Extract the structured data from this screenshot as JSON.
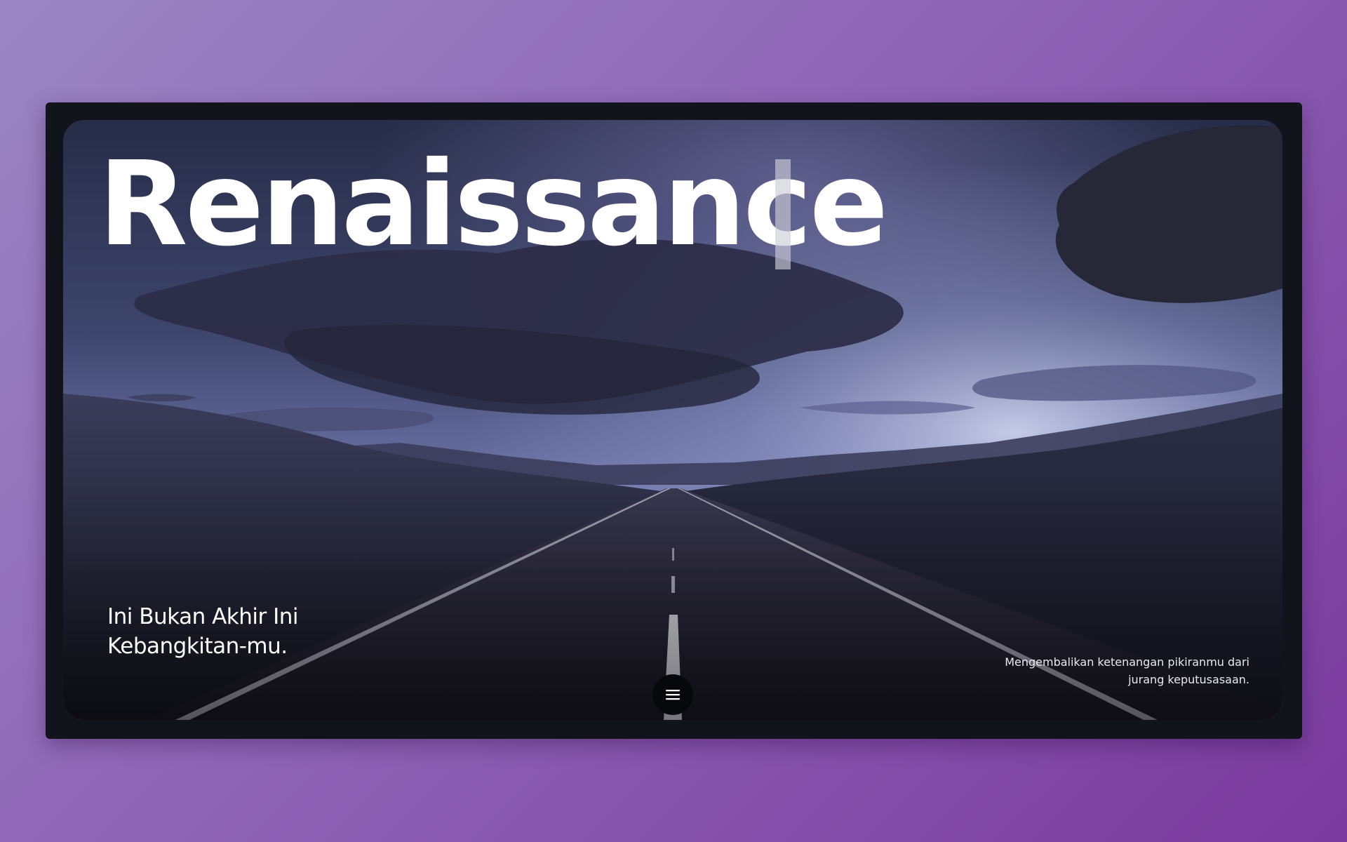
{
  "hero": {
    "title": "Renaissance",
    "tagline": "Ini Bukan Akhir Ini Kebangkitan-mu.",
    "subtitle": "Mengembalikan ketenangan pikiranmu dari jurang keputusasaan.",
    "background_image": "twilight desert highway with dramatic purple clouds",
    "menu_icon": "hamburger-menu-icon"
  },
  "colors": {
    "page_gradient_start": "#9a86c3",
    "page_gradient_end": "#7a3a9e",
    "frame": "#12141c",
    "menu_button": "#07080c",
    "title_text": "#ffffff"
  }
}
